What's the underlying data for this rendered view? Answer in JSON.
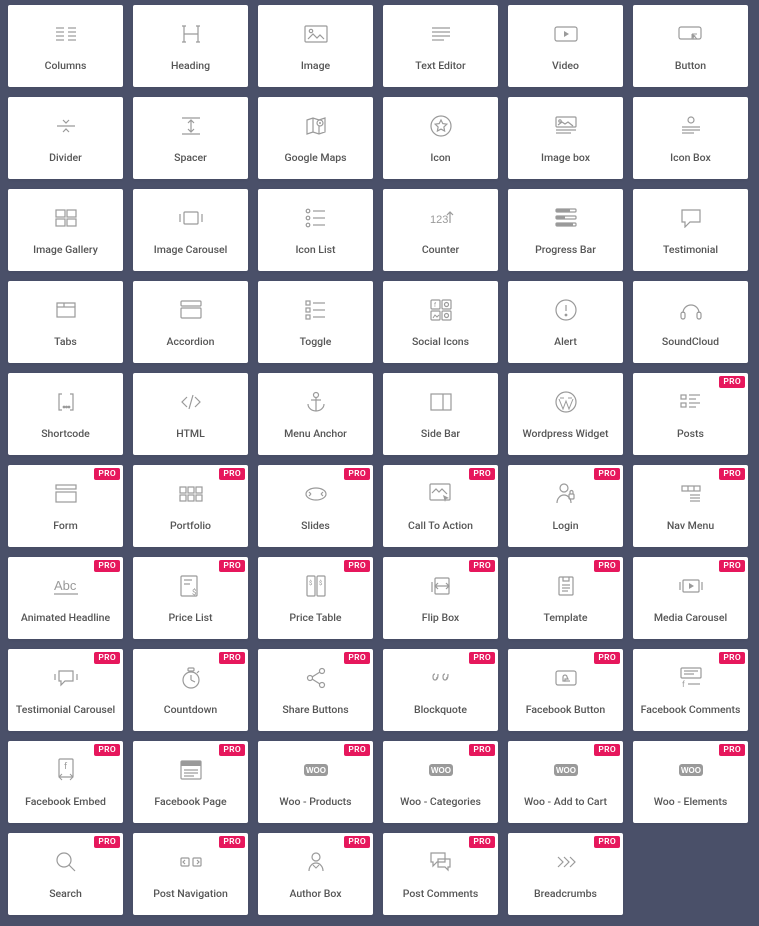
{
  "badge_text": "PRO",
  "colors": {
    "accent": "#e6175c",
    "icon": "#888",
    "bg": "#4a5069",
    "card": "#ffffff"
  },
  "widgets": [
    {
      "label": "Columns",
      "icon": "columns",
      "pro": false
    },
    {
      "label": "Heading",
      "icon": "heading",
      "pro": false
    },
    {
      "label": "Image",
      "icon": "image",
      "pro": false
    },
    {
      "label": "Text Editor",
      "icon": "text",
      "pro": false
    },
    {
      "label": "Video",
      "icon": "video",
      "pro": false
    },
    {
      "label": "Button",
      "icon": "button",
      "pro": false
    },
    {
      "label": "Divider",
      "icon": "divider",
      "pro": false
    },
    {
      "label": "Spacer",
      "icon": "spacer",
      "pro": false
    },
    {
      "label": "Google Maps",
      "icon": "map",
      "pro": false
    },
    {
      "label": "Icon",
      "icon": "star",
      "pro": false
    },
    {
      "label": "Image box",
      "icon": "imgbox",
      "pro": false
    },
    {
      "label": "Icon Box",
      "icon": "iconbox",
      "pro": false
    },
    {
      "label": "Image Gallery",
      "icon": "gallery",
      "pro": false
    },
    {
      "label": "Image Carousel",
      "icon": "carousel",
      "pro": false
    },
    {
      "label": "Icon List",
      "icon": "iconlist",
      "pro": false
    },
    {
      "label": "Counter",
      "icon": "counter",
      "pro": false
    },
    {
      "label": "Progress Bar",
      "icon": "progress",
      "pro": false
    },
    {
      "label": "Testimonial",
      "icon": "testimonial",
      "pro": false
    },
    {
      "label": "Tabs",
      "icon": "tabs",
      "pro": false
    },
    {
      "label": "Accordion",
      "icon": "accordion",
      "pro": false
    },
    {
      "label": "Toggle",
      "icon": "toggle",
      "pro": false
    },
    {
      "label": "Social Icons",
      "icon": "social",
      "pro": false
    },
    {
      "label": "Alert",
      "icon": "alert",
      "pro": false
    },
    {
      "label": "SoundCloud",
      "icon": "sound",
      "pro": false
    },
    {
      "label": "Shortcode",
      "icon": "shortcode",
      "pro": false
    },
    {
      "label": "HTML",
      "icon": "html",
      "pro": false
    },
    {
      "label": "Menu Anchor",
      "icon": "anchor",
      "pro": false
    },
    {
      "label": "Side Bar",
      "icon": "sidebar",
      "pro": false
    },
    {
      "label": "Wordpress Widget",
      "icon": "wordpress",
      "pro": false
    },
    {
      "label": "Posts",
      "icon": "posts",
      "pro": true
    },
    {
      "label": "Form",
      "icon": "form",
      "pro": true
    },
    {
      "label": "Portfolio",
      "icon": "portfolio",
      "pro": true
    },
    {
      "label": "Slides",
      "icon": "slides",
      "pro": true
    },
    {
      "label": "Call To Action",
      "icon": "cta",
      "pro": true
    },
    {
      "label": "Login",
      "icon": "login",
      "pro": true
    },
    {
      "label": "Nav Menu",
      "icon": "navmenu",
      "pro": true
    },
    {
      "label": "Animated Headline",
      "icon": "animhead",
      "pro": true
    },
    {
      "label": "Price List",
      "icon": "pricelist",
      "pro": true
    },
    {
      "label": "Price Table",
      "icon": "pricetable",
      "pro": true
    },
    {
      "label": "Flip Box",
      "icon": "flipbox",
      "pro": true
    },
    {
      "label": "Template",
      "icon": "template",
      "pro": true
    },
    {
      "label": "Media Carousel",
      "icon": "mediacar",
      "pro": true
    },
    {
      "label": "Testimonial Carousel",
      "icon": "testcar",
      "pro": true
    },
    {
      "label": "Countdown",
      "icon": "countdown",
      "pro": true
    },
    {
      "label": "Share Buttons",
      "icon": "share",
      "pro": true
    },
    {
      "label": "Blockquote",
      "icon": "blockquote",
      "pro": true
    },
    {
      "label": "Facebook Button",
      "icon": "fbbutton",
      "pro": true
    },
    {
      "label": "Facebook Comments",
      "icon": "fbcomments",
      "pro": true
    },
    {
      "label": "Facebook Embed",
      "icon": "fbembed",
      "pro": true
    },
    {
      "label": "Facebook Page",
      "icon": "fbpage",
      "pro": true
    },
    {
      "label": "Woo - Products",
      "icon": "woo",
      "pro": true
    },
    {
      "label": "Woo - Categories",
      "icon": "woo",
      "pro": true
    },
    {
      "label": "Woo - Add to Cart",
      "icon": "woo",
      "pro": true
    },
    {
      "label": "Woo - Elements",
      "icon": "woo",
      "pro": true
    },
    {
      "label": "Search",
      "icon": "search",
      "pro": true
    },
    {
      "label": "Post Navigation",
      "icon": "postnav",
      "pro": true
    },
    {
      "label": "Author Box",
      "icon": "author",
      "pro": true
    },
    {
      "label": "Post Comments",
      "icon": "postcomments",
      "pro": true
    },
    {
      "label": "Breadcrumbs",
      "icon": "breadcrumbs",
      "pro": true
    }
  ]
}
